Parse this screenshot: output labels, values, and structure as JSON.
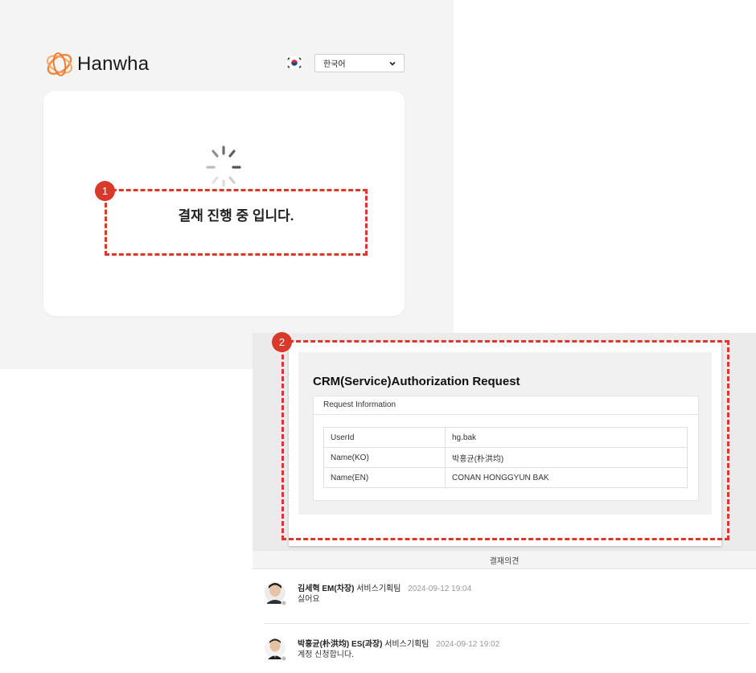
{
  "login": {
    "logo_text": "Hanwha",
    "flag_icon": "korea-flag-icon",
    "language": "한국어",
    "progress_message": "결재 진행 중 입니다.",
    "badge": "1"
  },
  "document": {
    "badge": "2",
    "title": "CRM(Service)Authorization Request",
    "section_header": "Request Information",
    "rows": [
      {
        "key": "UserId",
        "value": "hg.bak"
      },
      {
        "key": "Name(KO)",
        "value": "박홍균(朴洪均)"
      },
      {
        "key": "Name(EN)",
        "value": "CONAN HONGGYUN BAK"
      }
    ]
  },
  "opinions": {
    "header": "결재의견",
    "items": [
      {
        "name": "김세혁 EM(차장)",
        "team": "서비스기획팀",
        "date": "2024-09-12 19:04",
        "text": "싫어요"
      },
      {
        "name": "박홍균(朴洪均) ES(과장)",
        "team": "서비스기획팀",
        "date": "2024-09-12 19:02",
        "text": "계정 신청합니다."
      }
    ]
  },
  "colors": {
    "accent_red": "#d8392b",
    "logo_orange": "#f08a3c"
  }
}
